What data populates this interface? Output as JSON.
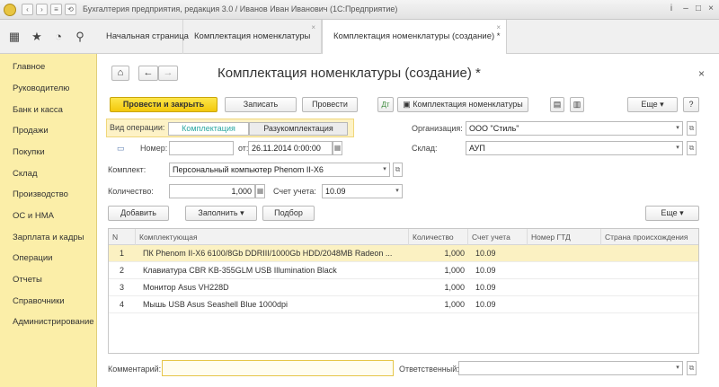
{
  "window": {
    "title": "Бухгалтерия предприятия, редакция 3.0 / Иванов Иван Иванович  (1С:Предприятие)",
    "title_right": "(1С:Предприятие)"
  },
  "tabs": [
    {
      "label": "Начальная страница"
    },
    {
      "label": "Комплектация номенклатуры"
    },
    {
      "label": "Комплектация номенклатуры (создание) *"
    }
  ],
  "sidebar": {
    "items": [
      {
        "label": "Главное"
      },
      {
        "label": "Руководителю"
      },
      {
        "label": "Банк и касса"
      },
      {
        "label": "Продажи"
      },
      {
        "label": "Покупки"
      },
      {
        "label": "Склад"
      },
      {
        "label": "Производство"
      },
      {
        "label": "ОС и НМА"
      },
      {
        "label": "Зарплата и кадры"
      },
      {
        "label": "Операции"
      },
      {
        "label": "Отчеты"
      },
      {
        "label": "Справочники"
      },
      {
        "label": "Администрирование"
      }
    ]
  },
  "form": {
    "title": "Комплектация номенклатуры (создание) *",
    "toolbar": {
      "post_close": "Провести и закрыть",
      "save": "Записать",
      "post": "Провести",
      "print": "Комплектация номенклатуры",
      "more": "Еще",
      "help": "?"
    },
    "operation": {
      "label": "Вид операции:",
      "option1": "Комплектация",
      "option2": "Разукомплектация"
    },
    "organization": {
      "label": "Организация:",
      "value": "ООО \"Стиль\""
    },
    "warehouse": {
      "label": "Склад:",
      "value": "АУП"
    },
    "number": {
      "label": "Номер:",
      "value": ""
    },
    "date": {
      "label": "от:",
      "value": "26.11.2014  0:00:00"
    },
    "kit": {
      "label": "Комплект:",
      "value": "Персональный компьютер Phenom II-X6"
    },
    "quantity": {
      "label": "Количество:",
      "value": "1,000"
    },
    "account": {
      "label": "Счет учета:",
      "value": "10.09"
    },
    "table_toolbar": {
      "add": "Добавить",
      "fill": "Заполнить",
      "select": "Подбор",
      "more": "Еще"
    },
    "table": {
      "columns": [
        "N",
        "Комплектующая",
        "Количество",
        "Счет учета",
        "Номер ГТД",
        "Страна происхождения"
      ],
      "rows": [
        {
          "n": "1",
          "item": "ПК Phenom II-X6 6100/8Gb DDRIII/1000Gb HDD/2048MB Radeon ...",
          "qty": "1,000",
          "account": "10.09"
        },
        {
          "n": "2",
          "item": "Клавиатура CBR KB-355GLM USB Illumination Black",
          "qty": "1,000",
          "account": "10.09"
        },
        {
          "n": "3",
          "item": "Монитор Asus VH228D",
          "qty": "1,000",
          "account": "10.09"
        },
        {
          "n": "4",
          "item": "Мышь USB Asus Seashell Blue 1000dpi",
          "qty": "1,000",
          "account": "10.09"
        }
      ]
    },
    "comment": {
      "label": "Комментарий:",
      "value": ""
    },
    "responsible": {
      "label": "Ответственный:",
      "value": ""
    }
  }
}
